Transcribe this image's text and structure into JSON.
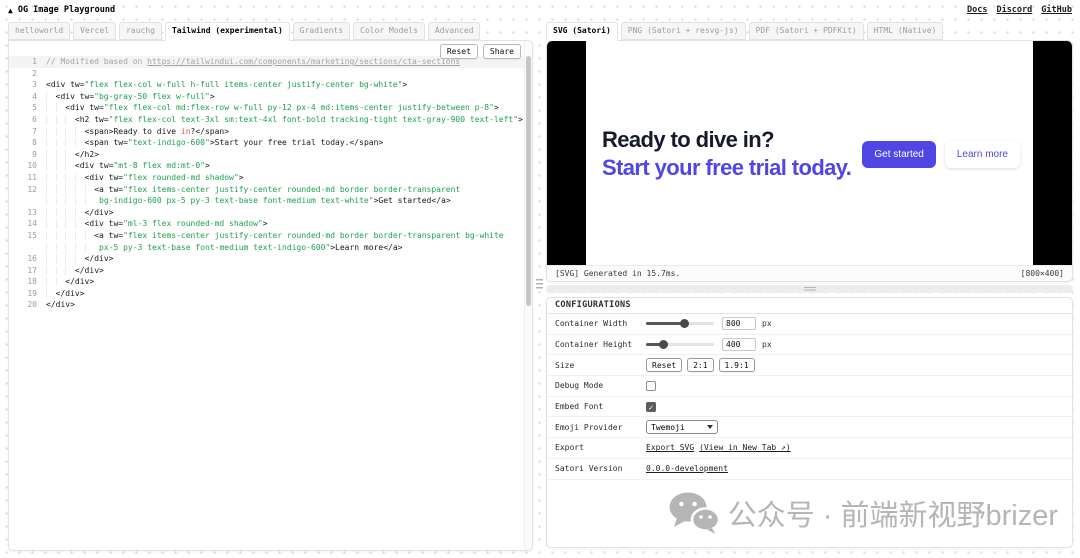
{
  "app": {
    "logo": "▲",
    "title": "OG Image Playground",
    "nav": [
      "Docs",
      "Discord",
      "GitHub"
    ]
  },
  "colors": {
    "accent": "#4f46e5",
    "string_green": "#1fa24e",
    "keyword_orange": "#e5593a",
    "preview_bg": "#000000",
    "card_band_bg": "#f8f9fb",
    "heading_dark": "#151b2c"
  },
  "editor": {
    "tabs": [
      {
        "label": "helloworld",
        "active": false
      },
      {
        "label": "Vercel",
        "active": false
      },
      {
        "label": "rauchg",
        "active": false
      },
      {
        "label": "Tailwind (experimental)",
        "active": true
      },
      {
        "label": "Gradients",
        "active": false
      },
      {
        "label": "Color Models",
        "active": false
      },
      {
        "label": "Advanced",
        "active": false
      }
    ],
    "toolbar": {
      "reset_label": "Reset",
      "share_label": "Share"
    },
    "code": [
      {
        "n": 1,
        "active": true,
        "rows": [
          [
            {
              "c": "cm",
              "t": "// Modified based on "
            },
            {
              "c": "cmu",
              "t": "https://tailwindui.com/components/marketing/sections/cta-sections"
            }
          ]
        ]
      },
      {
        "n": 2,
        "rows": [
          []
        ]
      },
      {
        "n": 3,
        "rows": [
          [
            {
              "c": "p",
              "t": "<div tw="
            },
            {
              "c": "s",
              "t": "\"flex flex-col w-full h-full items-center justify-center bg-white\""
            },
            {
              "c": "p",
              "t": ">"
            }
          ]
        ]
      },
      {
        "n": 4,
        "rows": [
          [
            {
              "c": "p",
              "t": "  <div tw="
            },
            {
              "c": "s",
              "t": "\"bg-gray-50 flex w-full\""
            },
            {
              "c": "p",
              "t": ">"
            }
          ]
        ]
      },
      {
        "n": 5,
        "rows": [
          [
            {
              "c": "p",
              "t": "    <div tw="
            },
            {
              "c": "s",
              "t": "\"flex flex-col md:flex-row w-full py-12 px-4 md:items-center justify-between p-8\""
            },
            {
              "c": "p",
              "t": ">"
            }
          ]
        ]
      },
      {
        "n": 6,
        "rows": [
          [
            {
              "c": "p",
              "t": "      <h2 tw="
            },
            {
              "c": "s",
              "t": "\"flex flex-col text-3xl sm:text-4xl font-bold tracking-tight text-gray-900 text-left\""
            },
            {
              "c": "p",
              "t": ">"
            }
          ]
        ]
      },
      {
        "n": 7,
        "rows": [
          [
            {
              "c": "p",
              "t": "        <span>Ready to dive "
            },
            {
              "c": "k",
              "t": "in"
            },
            {
              "c": "p",
              "t": "?</span>"
            }
          ]
        ]
      },
      {
        "n": 8,
        "rows": [
          [
            {
              "c": "p",
              "t": "        <span tw="
            },
            {
              "c": "s",
              "t": "\"text-indigo-600\""
            },
            {
              "c": "p",
              "t": ">Start your free trial today.</span>"
            }
          ]
        ]
      },
      {
        "n": 9,
        "rows": [
          [
            {
              "c": "p",
              "t": "      </h2>"
            }
          ]
        ]
      },
      {
        "n": 10,
        "rows": [
          [
            {
              "c": "p",
              "t": "      <div tw="
            },
            {
              "c": "s",
              "t": "\"mt-8 flex md:mt-0\""
            },
            {
              "c": "p",
              "t": ">"
            }
          ]
        ]
      },
      {
        "n": 11,
        "rows": [
          [
            {
              "c": "p",
              "t": "        <div tw="
            },
            {
              "c": "s",
              "t": "\"flex rounded-md shadow\""
            },
            {
              "c": "p",
              "t": ">"
            }
          ]
        ]
      },
      {
        "n": 12,
        "rows": [
          [
            {
              "c": "p",
              "t": "          <a tw="
            },
            {
              "c": "s",
              "t": "\"flex items-center justify-center rounded-md border border-transparent"
            }
          ],
          [
            {
              "c": "p",
              "t": "           "
            },
            {
              "c": "s",
              "t": "bg-indigo-600 px-5 py-3 text-base font-medium text-white\""
            },
            {
              "c": "p",
              "t": ">Get started</a>"
            }
          ]
        ]
      },
      {
        "n": 13,
        "rows": [
          [
            {
              "c": "p",
              "t": "        </div>"
            }
          ]
        ]
      },
      {
        "n": 14,
        "rows": [
          [
            {
              "c": "p",
              "t": "        <div tw="
            },
            {
              "c": "s",
              "t": "\"ml-3 flex rounded-md shadow\""
            },
            {
              "c": "p",
              "t": ">"
            }
          ]
        ]
      },
      {
        "n": 15,
        "rows": [
          [
            {
              "c": "p",
              "t": "          <a tw="
            },
            {
              "c": "s",
              "t": "\"flex items-center justify-center rounded-md border border-transparent bg-white"
            }
          ],
          [
            {
              "c": "p",
              "t": "           "
            },
            {
              "c": "s",
              "t": "px-5 py-3 text-base font-medium text-indigo-600\""
            },
            {
              "c": "p",
              "t": ">Learn more</a>"
            }
          ]
        ]
      },
      {
        "n": 16,
        "rows": [
          [
            {
              "c": "p",
              "t": "        </div>"
            }
          ]
        ]
      },
      {
        "n": 17,
        "rows": [
          [
            {
              "c": "p",
              "t": "      </div>"
            }
          ]
        ]
      },
      {
        "n": 18,
        "rows": [
          [
            {
              "c": "p",
              "t": "    </div>"
            }
          ]
        ]
      },
      {
        "n": 19,
        "rows": [
          [
            {
              "c": "p",
              "t": "  </div>"
            }
          ]
        ]
      },
      {
        "n": 20,
        "rows": [
          [
            {
              "c": "p",
              "t": "</div>"
            }
          ]
        ]
      }
    ]
  },
  "preview": {
    "tabs": [
      {
        "label": "SVG (Satori)",
        "active": true
      },
      {
        "label": "PNG (Satori + resvg-js)",
        "active": false
      },
      {
        "label": "PDF (Satori + PDFKit)",
        "active": false
      },
      {
        "label": "HTML (Native)",
        "active": false
      }
    ],
    "card": {
      "heading_line1": "Ready to dive in?",
      "heading_line2": "Start your free trial today.",
      "primary_button": "Get started",
      "secondary_button": "Learn more"
    },
    "status": {
      "left": "[SVG] Generated in 15.7ms.",
      "right": "[800×400]"
    }
  },
  "config": {
    "title": "CONFIGURATIONS",
    "rows": [
      {
        "type": "slider",
        "label": "Container Width",
        "value": "800",
        "unit": "px",
        "pct": 56
      },
      {
        "type": "slider",
        "label": "Container Height",
        "value": "400",
        "unit": "px",
        "pct": 25
      },
      {
        "type": "buttons",
        "label": "Size",
        "buttons": [
          "Reset",
          "2:1",
          "1.9:1"
        ]
      },
      {
        "type": "checkbox",
        "label": "Debug Mode",
        "checked": false
      },
      {
        "type": "checkbox",
        "label": "Embed Font",
        "checked": true
      },
      {
        "type": "select",
        "label": "Emoji Provider",
        "value": "Twemoji"
      },
      {
        "type": "links",
        "label": "Export",
        "links": [
          "Export SVG",
          "(View in New Tab ↗)"
        ]
      },
      {
        "type": "links",
        "label": "Satori Version",
        "links": [
          "0.0.0-development"
        ]
      }
    ]
  },
  "watermark": {
    "text": "公众号 · 前端新视野brizer"
  }
}
